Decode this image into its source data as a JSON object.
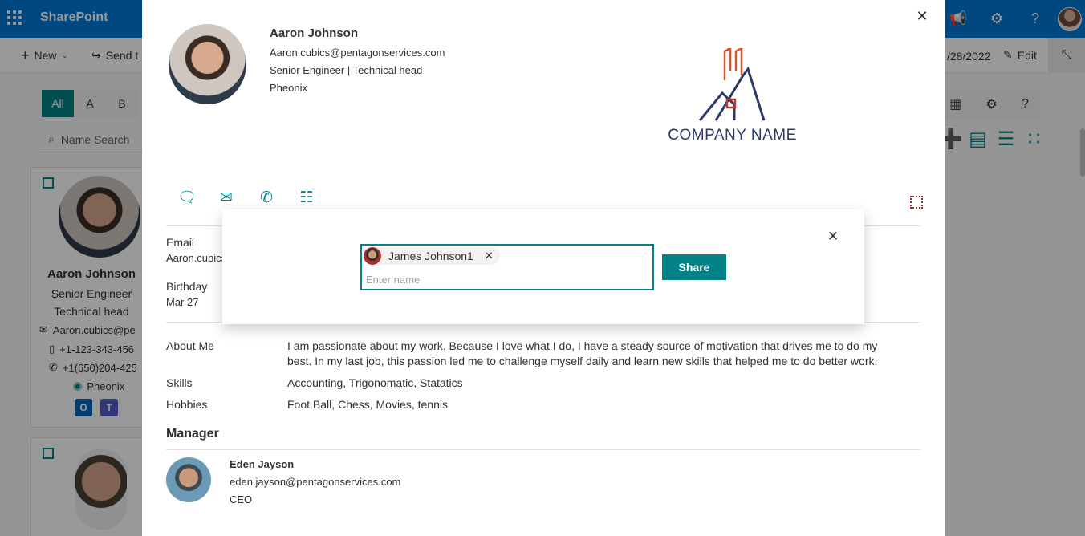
{
  "suite": {
    "app_name": "SharePoint",
    "icons": [
      "megaphone-icon",
      "gear-icon",
      "help-icon",
      "avatar"
    ]
  },
  "command_bar": {
    "new_label": "New",
    "send_label": "Send t",
    "date_text": "/28/2022",
    "edit_label": "Edit"
  },
  "directory": {
    "alphabet": [
      "All",
      "A",
      "B"
    ],
    "search_placeholder": "Name Search",
    "card1": {
      "name": "Aaron Johnson",
      "title_line1": "Senior Engineer",
      "title_line2": "Technical head",
      "email": "Aaron.cubics@pe",
      "phone": "+1-123-343-456",
      "mobile": "+1(650)204-425",
      "location": "Pheonix"
    }
  },
  "profile": {
    "name": "Aaron Johnson",
    "email": "Aaron.cubics@pentagonservices.com",
    "title": "Senior Engineer | Technical head",
    "location": "Pheonix",
    "logo_text": "COMPANY NAME",
    "email_label": "Email",
    "email_value": "Aaron.cubics",
    "birthday_label": "Birthday",
    "birthday_value": "Mar 27",
    "about_label": "About Me",
    "about_value": "I am passionate about my work. Because I love what I do, I have a steady source of motivation that drives me to do my best. In my last job, this passion led me to challenge myself daily and learn new skills that helped me to do better work.",
    "skills_label": "Skills",
    "skills_value": "Accounting, Trigonomatic, Statatics",
    "hobbies_label": "Hobbies",
    "hobbies_value": "Foot Ball, Chess, Movies, tennis",
    "manager_heading": "Manager",
    "manager": {
      "name": "Eden Jayson",
      "email": "eden.jayson@pentagonservices.com",
      "title": "CEO"
    }
  },
  "share_dialog": {
    "selected_person": "James Johnson1",
    "input_placeholder": "Enter name",
    "share_label": "Share"
  },
  "colors": {
    "suite_blue": "#0078d4",
    "teal_accent": "#038387",
    "logo_navy": "#2b3a67",
    "logo_orange": "#d9542b"
  }
}
